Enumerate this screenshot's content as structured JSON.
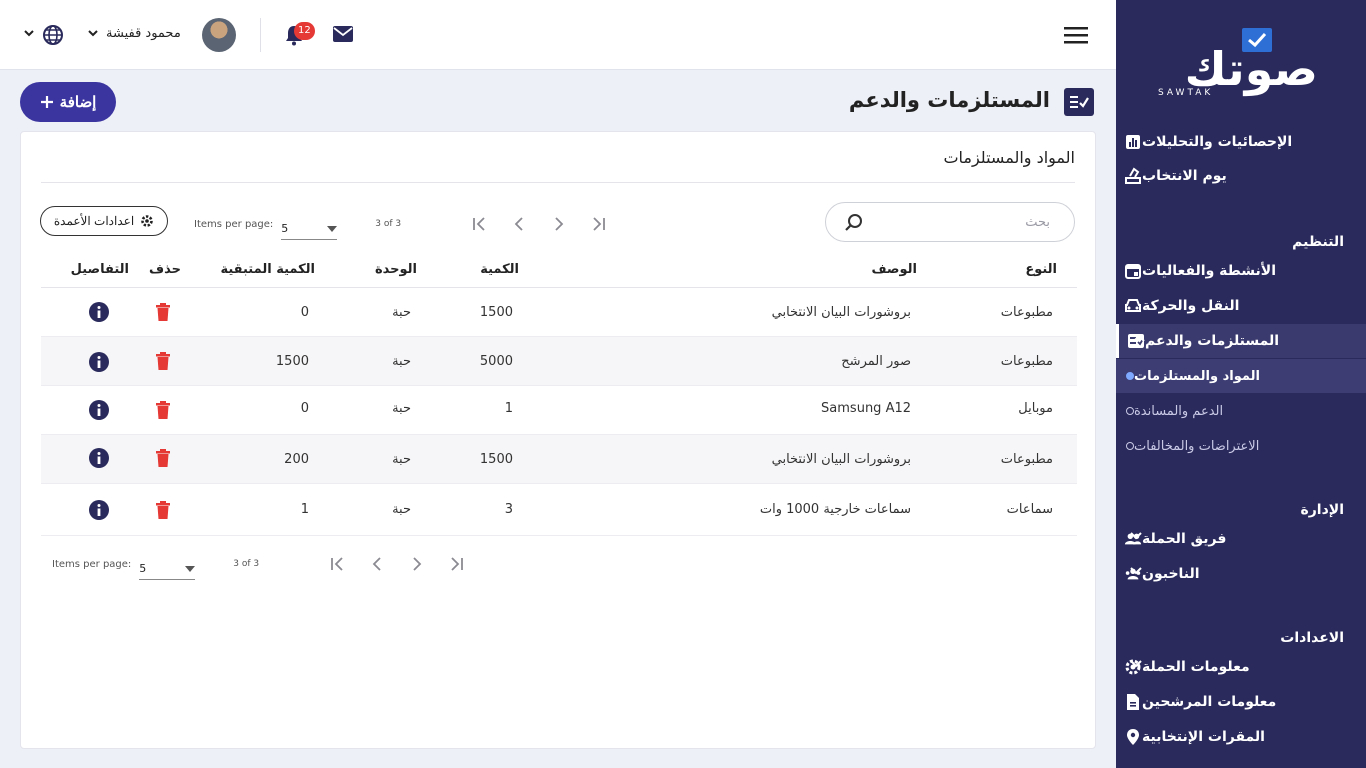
{
  "brand": {
    "logo_text": "صوتك",
    "logo_latin": "SAWTAK",
    "accent": "#2a2a5c",
    "primary": "#3b35a0"
  },
  "topbar": {
    "user_name": "محمود قفيشة",
    "notifications_count": "12"
  },
  "sidebar": {
    "top_items": [
      {
        "label": "الإحصائيات والتحليلات",
        "icon": "bar-chart-icon"
      },
      {
        "label": "يوم الانتخاب",
        "icon": "ballot-box-icon"
      }
    ],
    "section_organize": "التنظيم",
    "organize_items": [
      {
        "label": "الأنشطة والفعاليات",
        "icon": "calendar-icon"
      },
      {
        "label": "النقل والحركة",
        "icon": "car-icon"
      },
      {
        "label": "المستلزمات والدعم",
        "icon": "checklist-icon"
      }
    ],
    "sub_items": [
      {
        "label": "المواد والمستلزمات"
      },
      {
        "label": "الدعم والمساندة"
      },
      {
        "label": "الاعتراضات والمخالفات"
      }
    ],
    "section_admin": "الإدارة",
    "admin_items": [
      {
        "label": "فريق الحملة",
        "icon": "people-icon"
      },
      {
        "label": "الناخبون",
        "icon": "voters-icon"
      }
    ],
    "section_settings": "الاعدادات",
    "settings_items": [
      {
        "label": "معلومات الحملة",
        "icon": "gear-icon"
      },
      {
        "label": "معلومات المرشحين",
        "icon": "document-icon"
      },
      {
        "label": "المقرات الإنتخابية",
        "icon": "location-pin-icon"
      }
    ]
  },
  "page": {
    "title": "المستلزمات والدعم",
    "add_label": "إضافة"
  },
  "card": {
    "title": "المواد والمستلزمات",
    "search_placeholder": "بحث",
    "column_settings_label": "اعدادات الأعمدة",
    "pager": {
      "items_per_page_label": "Items per page:",
      "page_size": "5",
      "range": "3 of 3"
    },
    "columns": {
      "type": "النوع",
      "description": "الوصف",
      "quantity": "الكمية",
      "unit": "الوحدة",
      "remaining": "الكمية المتبقية",
      "delete": "حذف",
      "details": "التفاصيل"
    },
    "rows": [
      {
        "type": "مطبوعات",
        "description": "بروشورات البيان الانتخابي",
        "quantity": "1500",
        "unit": "حبة",
        "remaining": "0"
      },
      {
        "type": "مطبوعات",
        "description": "صور المرشح",
        "quantity": "5000",
        "unit": "حبة",
        "remaining": "1500"
      },
      {
        "type": "موبايل",
        "description": "Samsung A12",
        "quantity": "1",
        "unit": "حبة",
        "remaining": "0"
      },
      {
        "type": "مطبوعات",
        "description": "بروشورات البيان الانتخابي",
        "quantity": "1500",
        "unit": "حبة",
        "remaining": "200"
      },
      {
        "type": "سماعات",
        "description": "سماعات خارجية 1000 وات",
        "quantity": "3",
        "unit": "حبة",
        "remaining": "1"
      }
    ]
  }
}
